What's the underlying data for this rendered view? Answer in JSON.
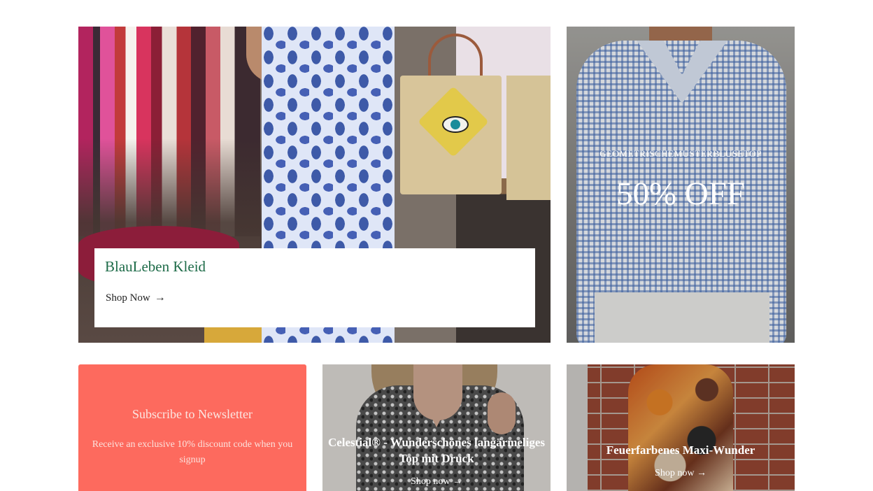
{
  "hero": {
    "title": "BlauLeben Kleid",
    "link_label": "Shop Now",
    "link_arrow": "→"
  },
  "promo": {
    "subtitle": "GEOMETRISCHEMUSTERBLUSETOP",
    "headline": "50% OFF"
  },
  "newsletter": {
    "title": "Subscribe to Newsletter",
    "text": "Receive an exclusive 10% discount code when you signup",
    "background_color": "#fd6a5e"
  },
  "sequin_card": {
    "title": "Celestial® - Wunderschönes langärmeliges Top mit Druck",
    "link_label": "Shop now",
    "link_arrow": "→"
  },
  "maxi_card": {
    "title": "Feuerfarbenes Maxi-Wunder",
    "link_label": "Shop now",
    "link_arrow": "→"
  },
  "colors": {
    "hero_title": "#1d6b48",
    "text_on_image": "#ffffff"
  }
}
